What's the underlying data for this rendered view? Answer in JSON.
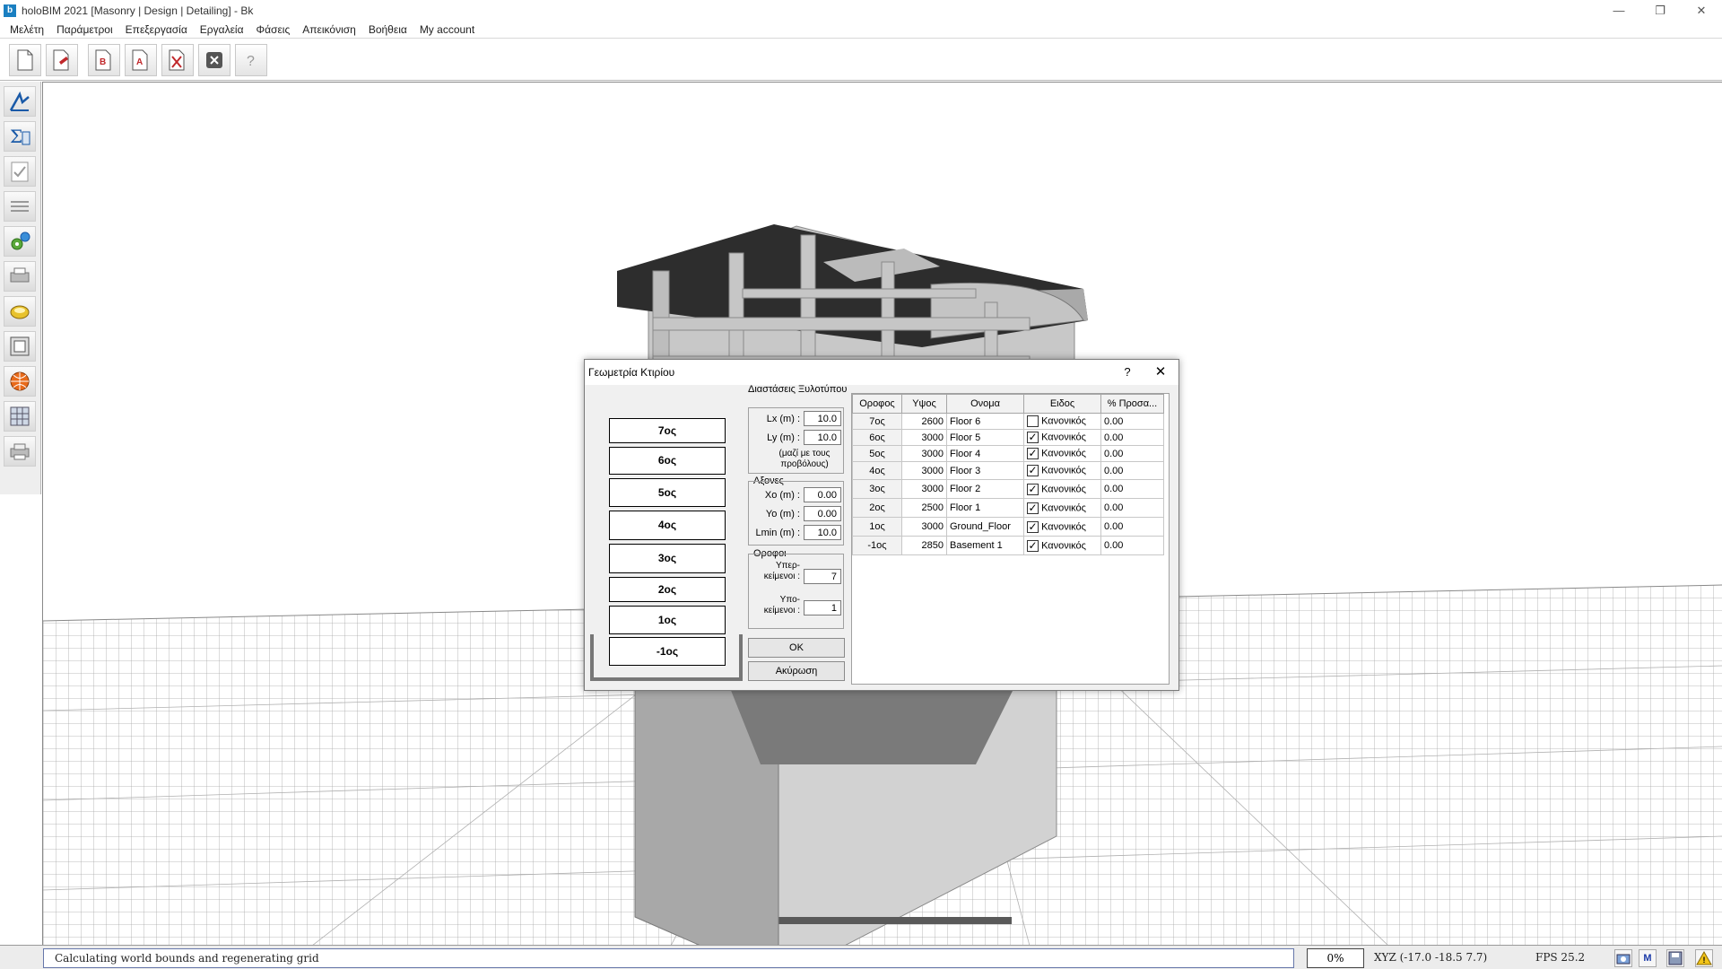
{
  "window": {
    "title": "holoBIM 2021 [Masonry | Design | Detailing] - Bk",
    "app_icon": "b",
    "controls": [
      "—",
      "❐",
      "✕"
    ]
  },
  "menu": [
    "Μελέτη",
    "Παράμετροι",
    "Επεξεργασία",
    "Εργαλεία",
    "Φάσεις",
    "Απεικόνιση",
    "Βοήθεια",
    "My account"
  ],
  "toolbar": {
    "buttons": [
      "new-file-icon",
      "open-file-icon",
      "export-b-icon",
      "export-a-icon",
      "delete-file-icon",
      "stop-icon",
      "help-icon"
    ],
    "labels": {
      "b": "B",
      "a": "A",
      "help": "?"
    }
  },
  "leftbar": {
    "tools": [
      "design-icon",
      "sum-icon",
      "check-icon",
      "layers-icon",
      "gear-icon",
      "printer-icon",
      "coin-icon",
      "frame-icon",
      "globe-icon",
      "grid-icon",
      "printer2-icon"
    ],
    "sum_glyph": "Σ"
  },
  "dialog": {
    "title": "Γεωμετρία Κτιρίου",
    "help": "?",
    "close": "✕",
    "floors_stack": [
      "7ος",
      "6ος",
      "5ος",
      "4ος",
      "3ος",
      "2ος",
      "1ος",
      "-1ος"
    ],
    "dims_group": {
      "label": "Διαστάσεις Ξυλοτύπου",
      "lx_label": "Lx (m) :",
      "lx": "10.0",
      "ly_label": "Ly (m) :",
      "ly": "10.0",
      "note": "(μαζί με τους προβόλους)"
    },
    "axes_group": {
      "label": "Αξονες",
      "xo_label": "Xo (m) :",
      "xo": "0.00",
      "yo_label": "Yo (m) :",
      "yo": "0.00",
      "lmin_label": "Lmin (m) :",
      "lmin": "10.0"
    },
    "floors_group": {
      "label": "Οροφοι",
      "above_label": "Υπερ-κείμενοι :",
      "above": "7",
      "below_label": "Υπο-κείμενοι :",
      "below": "1"
    },
    "ok": "OK",
    "cancel": "Ακύρωση",
    "table": {
      "headers": [
        "Οροφος",
        "Υψος",
        "Ονομα",
        "Ειδος",
        "% Προσα..."
      ],
      "rows": [
        {
          "floor": "7ος",
          "height": "2600",
          "name": "Floor 6",
          "checked": false,
          "type": "Κανονικός",
          "pct": "0.00"
        },
        {
          "floor": "6ος",
          "height": "3000",
          "name": "Floor 5",
          "checked": true,
          "type": "Κανονικός",
          "pct": "0.00"
        },
        {
          "floor": "5ος",
          "height": "3000",
          "name": "Floor 4",
          "checked": true,
          "type": "Κανονικός",
          "pct": "0.00"
        },
        {
          "floor": "4ος",
          "height": "3000",
          "name": "Floor 3",
          "checked": true,
          "type": "Κανονικός",
          "pct": "0.00"
        },
        {
          "floor": "3ος",
          "height": "3000",
          "name": "Floor 2",
          "checked": true,
          "type": "Κανονικός",
          "pct": "0.00"
        },
        {
          "floor": "2ος",
          "height": "2500",
          "name": "Floor 1",
          "checked": true,
          "type": "Κανονικός",
          "pct": "0.00"
        },
        {
          "floor": "1ος",
          "height": "3000",
          "name": "Ground_Floor",
          "checked": true,
          "type": "Κανονικός",
          "pct": "0.00"
        },
        {
          "floor": "-1ος",
          "height": "2850",
          "name": "Basement 1",
          "checked": true,
          "type": "Κανονικός",
          "pct": "0.00"
        }
      ]
    }
  },
  "status": {
    "message": "Calculating world bounds and regenerating grid",
    "percent": "0%",
    "xyz": "XYZ (-17.0 -18.5 7.7)",
    "fps": "FPS 25.2",
    "icons": [
      "camera-icon",
      "m-icon",
      "save-icon",
      "warning-icon"
    ],
    "m_label": "M",
    "warn_label": "!"
  },
  "colors": {
    "accent": "#1a7fc1",
    "structure": "#bcbcbc",
    "slab": "#2d2d2d"
  }
}
